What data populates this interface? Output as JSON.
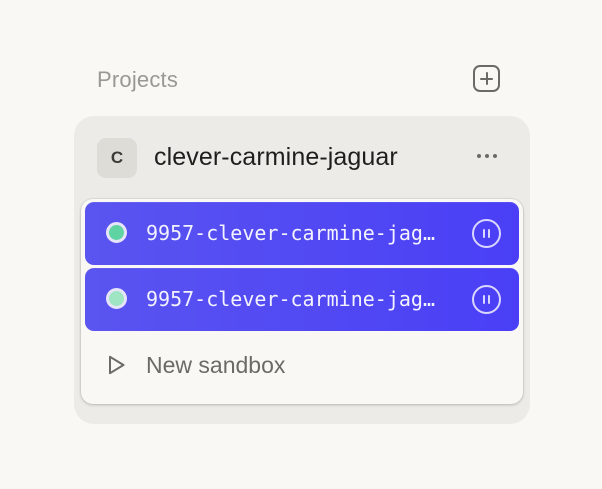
{
  "projects": {
    "title": "Projects",
    "add_icon": "plus-square-icon"
  },
  "project": {
    "avatar_letter": "C",
    "name": "clever-carmine-jaguar",
    "more_icon": "more-horizontal-icon",
    "sandboxes": [
      {
        "name": "9957-clever-carmine-jaguar",
        "status_color": "#5fd3a2",
        "action_icon": "pause-icon"
      },
      {
        "name": "9957-clever-carmine-jaguar",
        "status_color": "#9fe5c4",
        "action_icon": "pause-icon"
      }
    ],
    "new_sandbox_label": "New sandbox",
    "new_sandbox_icon": "play-icon"
  },
  "colors": {
    "accent": "#4f46f4",
    "background": "#f9f8f5",
    "card": "#ecebe7"
  }
}
